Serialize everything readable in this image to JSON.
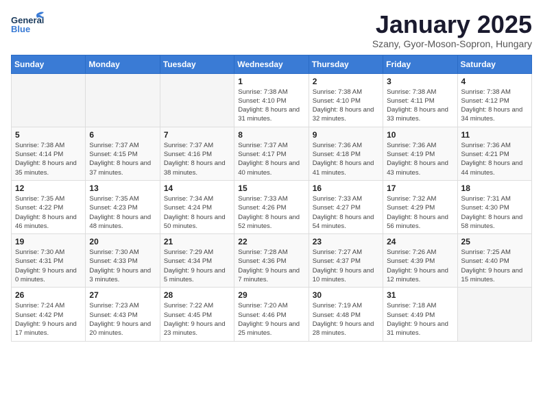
{
  "header": {
    "logo_general": "General",
    "logo_blue": "Blue",
    "month": "January 2025",
    "location": "Szany, Gyor-Moson-Sopron, Hungary"
  },
  "weekdays": [
    "Sunday",
    "Monday",
    "Tuesday",
    "Wednesday",
    "Thursday",
    "Friday",
    "Saturday"
  ],
  "weeks": [
    [
      {
        "day": "",
        "info": ""
      },
      {
        "day": "",
        "info": ""
      },
      {
        "day": "",
        "info": ""
      },
      {
        "day": "1",
        "info": "Sunrise: 7:38 AM\nSunset: 4:10 PM\nDaylight: 8 hours and 31 minutes."
      },
      {
        "day": "2",
        "info": "Sunrise: 7:38 AM\nSunset: 4:10 PM\nDaylight: 8 hours and 32 minutes."
      },
      {
        "day": "3",
        "info": "Sunrise: 7:38 AM\nSunset: 4:11 PM\nDaylight: 8 hours and 33 minutes."
      },
      {
        "day": "4",
        "info": "Sunrise: 7:38 AM\nSunset: 4:12 PM\nDaylight: 8 hours and 34 minutes."
      }
    ],
    [
      {
        "day": "5",
        "info": "Sunrise: 7:38 AM\nSunset: 4:14 PM\nDaylight: 8 hours and 35 minutes."
      },
      {
        "day": "6",
        "info": "Sunrise: 7:37 AM\nSunset: 4:15 PM\nDaylight: 8 hours and 37 minutes."
      },
      {
        "day": "7",
        "info": "Sunrise: 7:37 AM\nSunset: 4:16 PM\nDaylight: 8 hours and 38 minutes."
      },
      {
        "day": "8",
        "info": "Sunrise: 7:37 AM\nSunset: 4:17 PM\nDaylight: 8 hours and 40 minutes."
      },
      {
        "day": "9",
        "info": "Sunrise: 7:36 AM\nSunset: 4:18 PM\nDaylight: 8 hours and 41 minutes."
      },
      {
        "day": "10",
        "info": "Sunrise: 7:36 AM\nSunset: 4:19 PM\nDaylight: 8 hours and 43 minutes."
      },
      {
        "day": "11",
        "info": "Sunrise: 7:36 AM\nSunset: 4:21 PM\nDaylight: 8 hours and 44 minutes."
      }
    ],
    [
      {
        "day": "12",
        "info": "Sunrise: 7:35 AM\nSunset: 4:22 PM\nDaylight: 8 hours and 46 minutes."
      },
      {
        "day": "13",
        "info": "Sunrise: 7:35 AM\nSunset: 4:23 PM\nDaylight: 8 hours and 48 minutes."
      },
      {
        "day": "14",
        "info": "Sunrise: 7:34 AM\nSunset: 4:24 PM\nDaylight: 8 hours and 50 minutes."
      },
      {
        "day": "15",
        "info": "Sunrise: 7:33 AM\nSunset: 4:26 PM\nDaylight: 8 hours and 52 minutes."
      },
      {
        "day": "16",
        "info": "Sunrise: 7:33 AM\nSunset: 4:27 PM\nDaylight: 8 hours and 54 minutes."
      },
      {
        "day": "17",
        "info": "Sunrise: 7:32 AM\nSunset: 4:29 PM\nDaylight: 8 hours and 56 minutes."
      },
      {
        "day": "18",
        "info": "Sunrise: 7:31 AM\nSunset: 4:30 PM\nDaylight: 8 hours and 58 minutes."
      }
    ],
    [
      {
        "day": "19",
        "info": "Sunrise: 7:30 AM\nSunset: 4:31 PM\nDaylight: 9 hours and 0 minutes."
      },
      {
        "day": "20",
        "info": "Sunrise: 7:30 AM\nSunset: 4:33 PM\nDaylight: 9 hours and 3 minutes."
      },
      {
        "day": "21",
        "info": "Sunrise: 7:29 AM\nSunset: 4:34 PM\nDaylight: 9 hours and 5 minutes."
      },
      {
        "day": "22",
        "info": "Sunrise: 7:28 AM\nSunset: 4:36 PM\nDaylight: 9 hours and 7 minutes."
      },
      {
        "day": "23",
        "info": "Sunrise: 7:27 AM\nSunset: 4:37 PM\nDaylight: 9 hours and 10 minutes."
      },
      {
        "day": "24",
        "info": "Sunrise: 7:26 AM\nSunset: 4:39 PM\nDaylight: 9 hours and 12 minutes."
      },
      {
        "day": "25",
        "info": "Sunrise: 7:25 AM\nSunset: 4:40 PM\nDaylight: 9 hours and 15 minutes."
      }
    ],
    [
      {
        "day": "26",
        "info": "Sunrise: 7:24 AM\nSunset: 4:42 PM\nDaylight: 9 hours and 17 minutes."
      },
      {
        "day": "27",
        "info": "Sunrise: 7:23 AM\nSunset: 4:43 PM\nDaylight: 9 hours and 20 minutes."
      },
      {
        "day": "28",
        "info": "Sunrise: 7:22 AM\nSunset: 4:45 PM\nDaylight: 9 hours and 23 minutes."
      },
      {
        "day": "29",
        "info": "Sunrise: 7:20 AM\nSunset: 4:46 PM\nDaylight: 9 hours and 25 minutes."
      },
      {
        "day": "30",
        "info": "Sunrise: 7:19 AM\nSunset: 4:48 PM\nDaylight: 9 hours and 28 minutes."
      },
      {
        "day": "31",
        "info": "Sunrise: 7:18 AM\nSunset: 4:49 PM\nDaylight: 9 hours and 31 minutes."
      },
      {
        "day": "",
        "info": ""
      }
    ]
  ]
}
